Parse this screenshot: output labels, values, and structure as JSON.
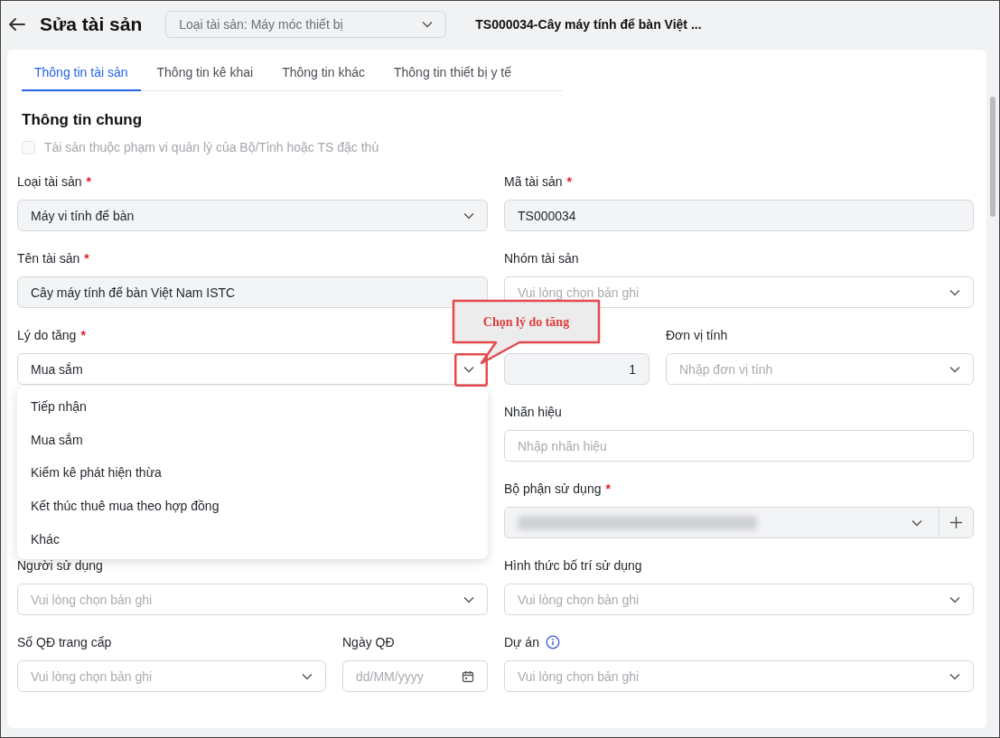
{
  "header": {
    "title": "Sửa tài sản",
    "category_select": {
      "value": "Loại tài sản: Máy móc thiết bị"
    },
    "record_title": "TS000034-Cây máy tính để bàn Việt ..."
  },
  "tabs": [
    {
      "label": "Thông tin tài sản",
      "selected": true
    },
    {
      "label": "Thông tin kê khai",
      "selected": false
    },
    {
      "label": "Thông tin khác",
      "selected": false
    },
    {
      "label": "Thông tin thiết bị y tế",
      "selected": false
    }
  ],
  "section": {
    "title": "Thông tin chung",
    "checkbox": {
      "label": "Tài sản thuộc phạm vi quản lý của Bộ/Tỉnh hoặc TS đặc thù",
      "checked": false,
      "disabled": true
    }
  },
  "fields": [
    {
      "label": "Loại tài sản",
      "required": true,
      "kind": "select",
      "value": "Máy vi tính để bàn",
      "readonly": true
    },
    {
      "label": "Mã tài sản",
      "required": true,
      "kind": "text",
      "value": "TS000034",
      "readonly": true
    },
    {
      "label": "Tên tài sản",
      "required": true,
      "kind": "text",
      "value": "Cây máy tính để bàn Việt Nam ISTC",
      "readonly": true
    },
    {
      "label": "Nhóm tài sản",
      "required": false,
      "kind": "select",
      "placeholder": "Vui lòng chọn bản ghi",
      "readonly": false
    },
    {
      "label": "Lý do tăng",
      "required": true,
      "kind": "select",
      "value": "Mua sắm",
      "readonly": false,
      "open": true,
      "options": [
        "Tiếp nhận",
        "Mua sắm",
        "Kiểm kê phát hiện thừa",
        "Kết thúc thuê mua theo hợp đồng",
        "Khác"
      ]
    },
    {
      "kind": "number",
      "value": "1",
      "readonly": true
    },
    {
      "label": "Đơn vị tính",
      "required": false,
      "kind": "select",
      "placeholder": "Nhập đơn vị tính",
      "readonly": false
    },
    {
      "label": "Nhãn hiệu",
      "required": false,
      "kind": "text",
      "placeholder": "Nhập nhãn hiệu",
      "readonly": false
    },
    {
      "label": "Bộ phận sử dụng",
      "required": true,
      "kind": "select_add",
      "masked": true,
      "readonly": true
    },
    {
      "label": "Người sử dụng",
      "required": false,
      "kind": "select",
      "placeholder": "Vui lòng chọn bản ghi",
      "readonly": false
    },
    {
      "label": "Hình thức bố trí sử dụng",
      "required": false,
      "kind": "select",
      "placeholder": "Vui lòng chọn bản ghi",
      "readonly": false
    },
    {
      "label": "Số QĐ trang cấp",
      "required": false,
      "kind": "select",
      "placeholder": "Vui lòng chọn bản ghi",
      "readonly": false
    },
    {
      "label": "Ngày QĐ",
      "required": false,
      "kind": "date",
      "placeholder": "dd/MM/yyyy",
      "readonly": false
    },
    {
      "label": "Dự án",
      "required": false,
      "info": true,
      "kind": "select",
      "placeholder": "Vui lòng chọn bản ghi",
      "readonly": false
    }
  ],
  "required_mark": "*",
  "callout": {
    "text": "Chọn lý do tăng"
  }
}
